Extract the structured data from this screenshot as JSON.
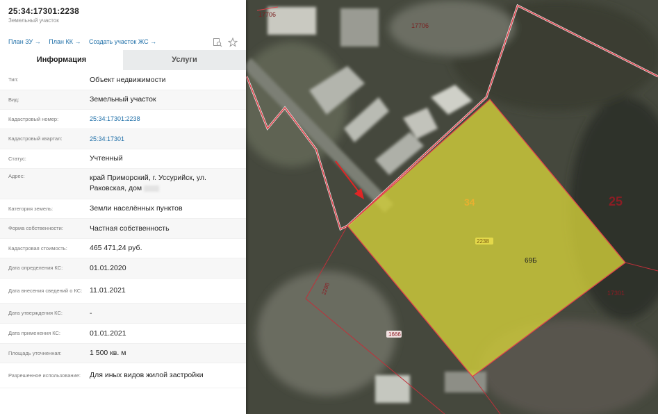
{
  "header": {
    "cadastral_number": "25:34:17301:2238",
    "object_kind": "Земельный участок"
  },
  "links": [
    "План ЗУ",
    "План КК",
    "Создать участок ЖС"
  ],
  "icons": {
    "link_arrow": "arrow-right-icon",
    "tool1": "search-doc-icon",
    "tool2": "star-icon"
  },
  "tabs": [
    {
      "label": "Информация",
      "active": true
    },
    {
      "label": "Услуги",
      "active": false
    }
  ],
  "rows": [
    {
      "label": "Тип:",
      "value": "Объект недвижимости"
    },
    {
      "label": "Вид:",
      "value": "Земельный участок"
    },
    {
      "label": "Кадастровый номер:",
      "value": "25:34:17301:2238",
      "link": true
    },
    {
      "label": "Кадастровый квартал:",
      "value": "25:34:17301",
      "link": true
    },
    {
      "label": "Статус:",
      "value": "Учтенный"
    },
    {
      "label": "Адрес:",
      "value": "край Приморский, г. Уссурийск, ул. Раковская, дом",
      "blurred_suffix": true
    },
    {
      "label": "Категория земель:",
      "value": "Земли населённых пунктов"
    },
    {
      "label": "Форма собственности:",
      "value": "Частная собственность"
    },
    {
      "label": "Кадастровая стоимость:",
      "value": "465 471,24 руб."
    },
    {
      "label": "Дата определения КС:",
      "value": "01.01.2020"
    },
    {
      "label": "Дата внесения сведений о КС:",
      "value": "11.01.2021"
    },
    {
      "label": "Дата утверждения КС:",
      "value": "-"
    },
    {
      "label": "Дата применения КС:",
      "value": "01.01.2021"
    },
    {
      "label": "Площадь уточненная:",
      "value": "1 500 кв. м"
    },
    {
      "label": "Разрешенное использование:",
      "value": "Для иных видов жилой застройки"
    }
  ],
  "map_labels": {
    "top_left": "17706",
    "top_mid": "17706",
    "kvartal_left": "34",
    "kvartal_right": "25",
    "parcel": "2238",
    "house": "69Б",
    "right_block": "17301",
    "side_parcel": "2288",
    "bottom_parcel": "1666"
  },
  "colors": {
    "link": "#1f6fa8",
    "parcel_fill": "#d6d23a",
    "boundary": "#e0404a"
  }
}
